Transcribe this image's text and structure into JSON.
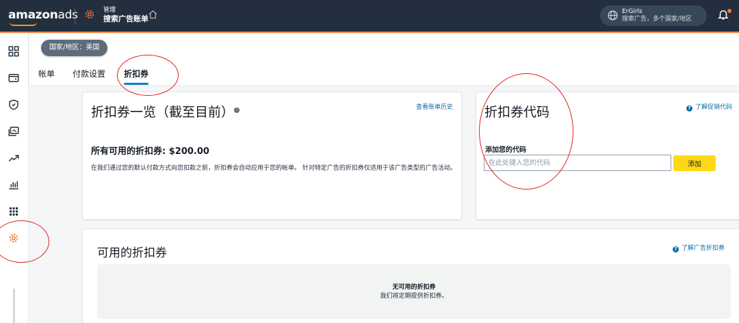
{
  "topbar": {
    "logo_main": "amazon",
    "logo_ads": "ads",
    "crumb_small": "管理",
    "crumb_big": "搜索广告账单",
    "account_name": "ErGirls",
    "account_sub": "搜索广告，多个国家/地区"
  },
  "sidenav": {
    "icons": [
      "dashboard-icon",
      "wallet-icon",
      "shield-icon",
      "media-icon",
      "trend-icon",
      "bar-chart-icon",
      "apps-grid-icon",
      "settings-gear-icon"
    ]
  },
  "subheader": {
    "region_pill": "国家/地区：美国",
    "tabs": [
      {
        "label": "帐单"
      },
      {
        "label": "付款设置"
      },
      {
        "label": "折扣券"
      }
    ]
  },
  "summary_card": {
    "title": "折扣券一览（截至目前）",
    "history_link": "查看账单历史",
    "total": "所有可用的折扣券: $200.00",
    "description": "在我们通过您的默认付款方式向您扣款之前，折扣券会自动应用于您的帐单。 针对特定广告的折扣券仅适用于该广告类型的广告活动。"
  },
  "code_card": {
    "title": "折扣券代码",
    "learn_link": "了解促销代码",
    "field_label": "添加您的代码",
    "input_placeholder": "在此处键入您的代码",
    "input_value": "",
    "add_button": "添加"
  },
  "available_card": {
    "title": "可用的折扣券",
    "learn_link": "了解广告折扣券",
    "empty_title": "无可用的折扣券",
    "empty_sub": "我们将定期提供折扣券。"
  },
  "colors": {
    "topbar": "#232f3e",
    "accent_orange": "#f2772e",
    "link_blue": "#0b6ea9",
    "button_yellow": "#ffd814",
    "annotation_red": "#e0201b"
  }
}
